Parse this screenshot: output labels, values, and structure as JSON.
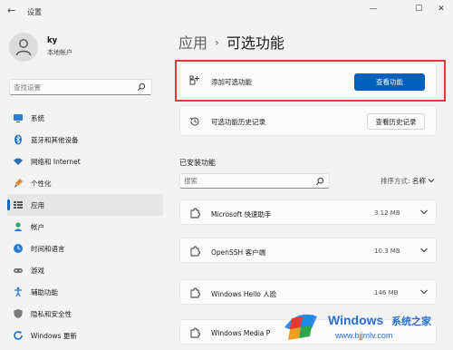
{
  "window": {
    "title": "设置",
    "back_glyph": "←",
    "minimize_glyph": "—",
    "maximize_glyph": "☐",
    "close_glyph": "✕"
  },
  "profile": {
    "name": "ky",
    "account_type": "本地帐户"
  },
  "sidebar": {
    "search_placeholder": "查找设置",
    "items": [
      {
        "label": "系统",
        "icon": "monitor-icon"
      },
      {
        "label": "蓝牙和其他设备",
        "icon": "bluetooth-icon"
      },
      {
        "label": "网络和 Internet",
        "icon": "wifi-icon"
      },
      {
        "label": "个性化",
        "icon": "brush-icon"
      },
      {
        "label": "应用",
        "icon": "apps-icon",
        "active": true
      },
      {
        "label": "帐户",
        "icon": "person-icon"
      },
      {
        "label": "时间和语言",
        "icon": "globe-clock-icon"
      },
      {
        "label": "游戏",
        "icon": "gamepad-icon"
      },
      {
        "label": "辅助功能",
        "icon": "accessibility-icon"
      },
      {
        "label": "隐私和安全性",
        "icon": "shield-icon"
      },
      {
        "label": "Windows 更新",
        "icon": "refresh-icon"
      }
    ]
  },
  "breadcrumb": {
    "parent": "应用",
    "separator": "›",
    "current": "可选功能"
  },
  "add_feature": {
    "label": "添加可选功能",
    "button": "查看功能"
  },
  "history": {
    "label": "可选功能历史记录",
    "button": "查看历史记录"
  },
  "installed": {
    "title": "已安装功能",
    "search_placeholder": "搜索",
    "sort_label": "排序方式:",
    "sort_value": "名称",
    "features": [
      {
        "name": "Microsoft 快速助手",
        "size": "3.12 MB"
      },
      {
        "name": "OpenSSH 客户端",
        "size": "10.3 MB"
      },
      {
        "name": "Windows Hello 人脸",
        "size": "146 MB"
      },
      {
        "name": "Windows Media P",
        "size": ""
      }
    ]
  },
  "watermark": {
    "brand": "Windows",
    "cn": "系统之家",
    "url": "www.bjjmlv.com"
  },
  "colors": {
    "accent": "#005fb8",
    "highlight": "#e33b3b",
    "background": "#f3f3f3",
    "card": "#fbfbfb"
  }
}
